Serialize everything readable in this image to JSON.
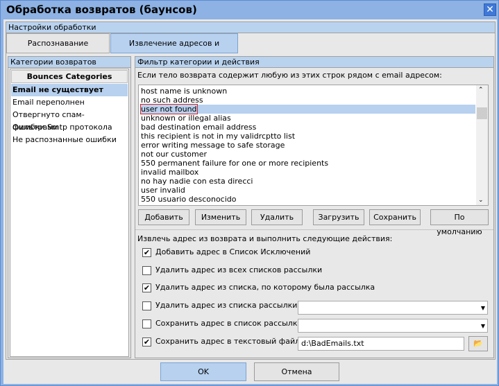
{
  "window": {
    "title": "Обработка возвратов (баунсов)",
    "close_icon": "close-icon"
  },
  "settings_group": {
    "title": "Настройки обработки"
  },
  "tabs": [
    {
      "label": "Распознавание возвратов",
      "selected": false
    },
    {
      "label": "Извлечение адресов и действия",
      "selected": true
    }
  ],
  "categories": {
    "title": "Категории возвратов",
    "header": "Bounces Categories",
    "items": [
      "Email не существует",
      "Email переполнен",
      "Отвергнуто спам-фильтрами",
      "Ошибки Smtp протокола",
      "Не распознанные ошибки"
    ],
    "selected": 0
  },
  "filter": {
    "title": "Фильтр категории и действия",
    "prompt": "Если тело возврата содержит любую из этих строк рядом с email адресом:",
    "strings": [
      "host name is unknown",
      "no such address",
      "user not found",
      "unknown or illegal alias",
      "bad destination email address",
      "this recipient is not in my validrcptto list",
      "error writing message to safe storage",
      "not our customer",
      "550 permanent failure for one or more recipients",
      "invalid mailbox",
      "no hay nadie con esta direcci",
      "user invalid",
      "550 usuario desconocido"
    ],
    "selected": 2,
    "buttons": {
      "add": "Добавить",
      "edit": "Изменить",
      "delete": "Удалить",
      "load": "Загрузить",
      "save": "Сохранить",
      "default": "По умолчанию"
    }
  },
  "actions": {
    "prompt": "Извлечь адрес из возврата и выполнить следующие действия:",
    "items": [
      {
        "label": "Добавить адрес в Список Исключений",
        "checked": true
      },
      {
        "label": "Удалить адрес из всех списков рассылки",
        "checked": false
      },
      {
        "label": "Удалить адрес из списка, по которому была рассылка",
        "checked": true
      },
      {
        "label": "Удалить адрес из списка рассылки:",
        "checked": false,
        "value": ""
      },
      {
        "label": "Сохранить адрес в список рассылки:",
        "checked": false,
        "value": ""
      },
      {
        "label": "Сохранить адрес в текстовый файл:",
        "checked": true,
        "value": "d:\\BadEmails.txt"
      }
    ]
  },
  "footer": {
    "ok": "OK",
    "cancel": "Отмена"
  },
  "colors": {
    "accent": "#b7d1ef",
    "titlebar": "#8db2e3",
    "highlight_border": "#e02020"
  }
}
